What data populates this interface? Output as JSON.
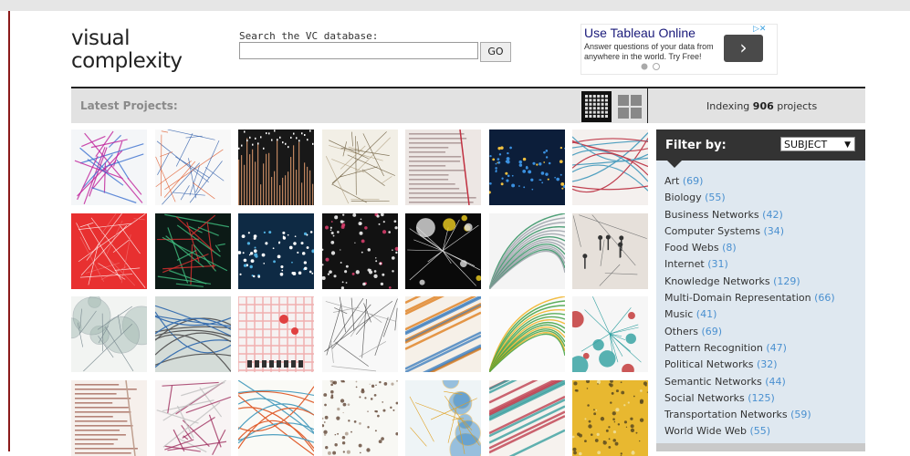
{
  "logo": {
    "line1": "visual",
    "line2": "complexity"
  },
  "search": {
    "label": "Search the VC database:",
    "value": "",
    "placeholder": "",
    "go_label": "GO"
  },
  "ad": {
    "title": "Use Tableau Online",
    "text": "Answer questions of your data from anywhere in the world. Try Free!",
    "arrow": "›",
    "badge": "▷✕"
  },
  "toolbar": {
    "latest_label": "Latest Projects:",
    "indexing_prefix": "Indexing",
    "indexing_count": "906",
    "indexing_suffix": "projects"
  },
  "filter": {
    "title": "Filter by:",
    "selected": "SUBJECT",
    "items": [
      {
        "label": "Art",
        "count": "(69)"
      },
      {
        "label": "Biology",
        "count": "(55)"
      },
      {
        "label": "Business Networks",
        "count": "(42)"
      },
      {
        "label": "Computer Systems",
        "count": "(34)"
      },
      {
        "label": "Food Webs",
        "count": "(8)"
      },
      {
        "label": "Internet",
        "count": "(31)"
      },
      {
        "label": "Knowledge Networks",
        "count": "(129)"
      },
      {
        "label": "Multi-Domain Representation",
        "count": "(66)"
      },
      {
        "label": "Music",
        "count": "(41)"
      },
      {
        "label": "Others",
        "count": "(69)"
      },
      {
        "label": "Pattern Recognition",
        "count": "(47)"
      },
      {
        "label": "Political Networks",
        "count": "(32)"
      },
      {
        "label": "Semantic Networks",
        "count": "(44)"
      },
      {
        "label": "Social Networks",
        "count": "(125)"
      },
      {
        "label": "Transportation Networks",
        "count": "(59)"
      },
      {
        "label": "World Wide Web",
        "count": "(55)"
      }
    ]
  },
  "colors": {
    "accent_rule": "#8b1a1a",
    "count_link": "#4a90d0",
    "filter_header": "#333333",
    "sidebar_bg": "#dfe8f0"
  },
  "thumbnails": [
    {
      "bg": "#f4f6f8",
      "fg": "#c0209a",
      "fg2": "#3a70d0",
      "style": "lines"
    },
    {
      "bg": "#f8f8f8",
      "fg": "#2a5aa8",
      "fg2": "#e05a2a",
      "style": "web"
    },
    {
      "bg": "#181818",
      "fg": "#e8a070",
      "fg2": "#ffffff",
      "style": "bars"
    },
    {
      "bg": "#f2efe6",
      "fg": "#6a5a3a",
      "fg2": "#b0a080",
      "style": "web"
    },
    {
      "bg": "#ede7e4",
      "fg": "#8a7070",
      "fg2": "#c03040",
      "style": "text"
    },
    {
      "bg": "#0c1e3a",
      "fg": "#3a90e0",
      "fg2": "#f0c040",
      "style": "map"
    },
    {
      "bg": "#f4f0ee",
      "fg": "#c04050",
      "fg2": "#50a0c0",
      "style": "arcs"
    },
    {
      "bg": "#e83030",
      "fg": "#ffffff",
      "fg2": "#f07070",
      "style": "web"
    },
    {
      "bg": "#0c1a16",
      "fg": "#40c080",
      "fg2": "#e03030",
      "style": "lines"
    },
    {
      "bg": "#0e2a44",
      "fg": "#ffffff",
      "fg2": "#50b0e0",
      "style": "map"
    },
    {
      "bg": "#121212",
      "fg": "#ffffff",
      "fg2": "#e04070",
      "style": "dots"
    },
    {
      "bg": "#0a0a0a",
      "fg": "#e0e0e0",
      "fg2": "#f0d020",
      "style": "nodes"
    },
    {
      "bg": "#f4f4f4",
      "fg": "#309060",
      "fg2": "#9aa0a8",
      "style": "fan"
    },
    {
      "bg": "#e6e0da",
      "fg": "#333333",
      "fg2": "#777777",
      "style": "figures"
    },
    {
      "bg": "#f2f4f2",
      "fg": "#a0b8b0",
      "fg2": "#7a8a90",
      "style": "circles"
    },
    {
      "bg": "#d4dcd8",
      "fg": "#3a70b0",
      "fg2": "#5a5a5a",
      "style": "arcs"
    },
    {
      "bg": "#f6f2f2",
      "fg": "#e04040",
      "fg2": "#303030",
      "style": "grid"
    },
    {
      "bg": "#f8f8f8",
      "fg": "#444444",
      "fg2": "#999999",
      "style": "web"
    },
    {
      "bg": "#f6f0e8",
      "fg": "#e08020",
      "fg2": "#4080c0",
      "style": "diag"
    },
    {
      "bg": "#fafafa",
      "fg": "#f0b020",
      "fg2": "#40a040",
      "style": "fan"
    },
    {
      "bg": "#f6f6f6",
      "fg": "#30a0a0",
      "fg2": "#c03030",
      "style": "nodes"
    },
    {
      "bg": "#f6f0ec",
      "fg": "#8a3a2a",
      "fg2": "#c0a090",
      "style": "text"
    },
    {
      "bg": "#f8f4f4",
      "fg": "#a03060",
      "fg2": "#c0c0c0",
      "style": "lines"
    },
    {
      "bg": "#fafaf6",
      "fg": "#e06030",
      "fg2": "#50a0c0",
      "style": "arcs"
    },
    {
      "bg": "#f8f8f4",
      "fg": "#6a5040",
      "fg2": "#b0a090",
      "style": "dots"
    },
    {
      "bg": "#eef4f6",
      "fg": "#3080c0",
      "fg2": "#e0a020",
      "style": "circles"
    },
    {
      "bg": "#f6f2ee",
      "fg": "#c04050",
      "fg2": "#3aa0a0",
      "style": "diag"
    },
    {
      "bg": "#e8b830",
      "fg": "#5a4a20",
      "fg2": "#f0e0a0",
      "style": "dots"
    }
  ]
}
